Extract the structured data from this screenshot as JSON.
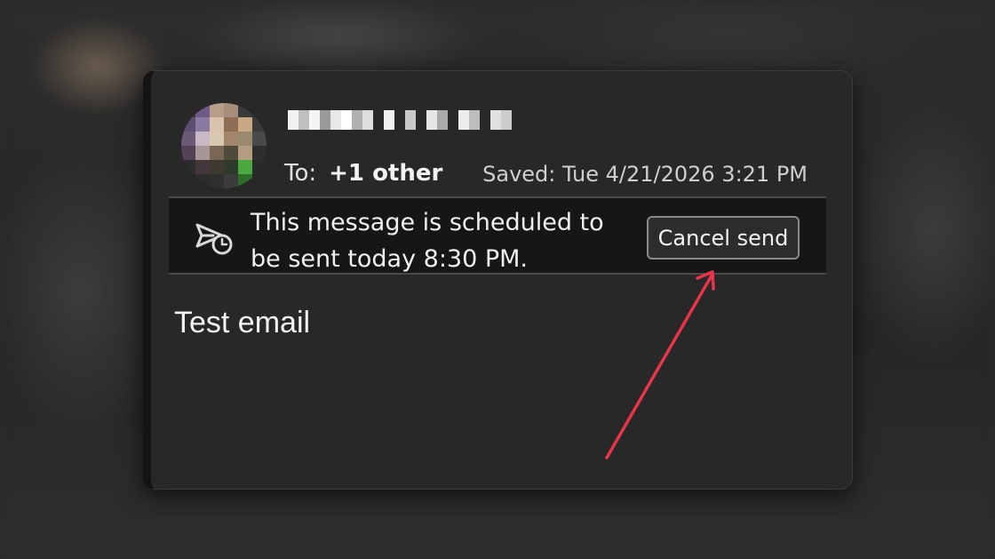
{
  "header": {
    "to_label": "To:",
    "to_value": "+1 other",
    "saved_text": "Saved: Tue 4/21/2026 3:21 PM"
  },
  "banner": {
    "icon": "scheduled-send-icon",
    "message": "This message is scheduled to be sent today 8:30 PM.",
    "cancel_label": "Cancel send"
  },
  "body": {
    "text": "Test email"
  },
  "annotation": {
    "color": "#e8354b"
  }
}
